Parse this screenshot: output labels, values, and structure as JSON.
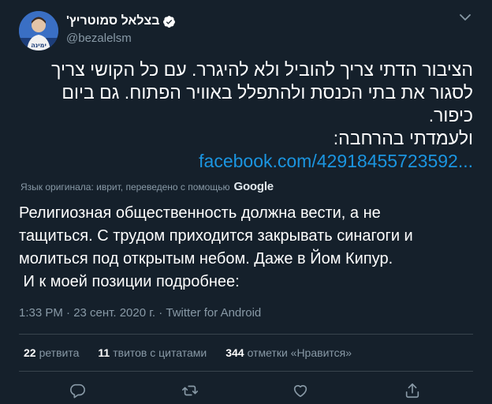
{
  "author": {
    "display_name": "בצלאל סמוטריץ'",
    "handle": "@bezalelsm",
    "verified": true,
    "avatar_icon": "profile-photo",
    "avatar_text": "ימינה"
  },
  "original_text": {
    "lines": [
      "הציבור הדתי צריך להוביל ולא להיגרר. עם כל הקושי צריך",
      "לסגור את בתי הכנסת ולהתפלל באוויר הפתוח. גם ביום",
      "כיפור.",
      "ולעמדתי בהרחבה:"
    ],
    "link": "facebook.com/42918455723592..."
  },
  "translation_attribution": {
    "text": "Язык оригинала: иврит, переведено с помощью",
    "provider": "Google"
  },
  "translated_text": {
    "lines": [
      "Религиозная общественность должна вести, а не",
      "тащиться. С трудом приходится закрывать синагоги и",
      "молиться под открытым небом. Даже в Йом Кипур.",
      " И к моей позиции подробнее:"
    ]
  },
  "meta": {
    "timestamp": "1:33 PM · 23 сент. 2020 г. · Twitter for Android"
  },
  "stats": {
    "retweets_count": "22",
    "retweets_label": "ретвита",
    "quotes_count": "11",
    "quotes_label": "твитов с цитатами",
    "likes_count": "344",
    "likes_label": "отметки «Нравится»"
  },
  "actions": {
    "reply_icon": "reply-icon",
    "retweet_icon": "retweet-icon",
    "like_icon": "heart-icon",
    "share_icon": "share-icon"
  },
  "colors": {
    "background": "#15202b",
    "text": "#ffffff",
    "secondary": "#8899a6",
    "link": "#1b95e0",
    "divider": "#38444d"
  }
}
